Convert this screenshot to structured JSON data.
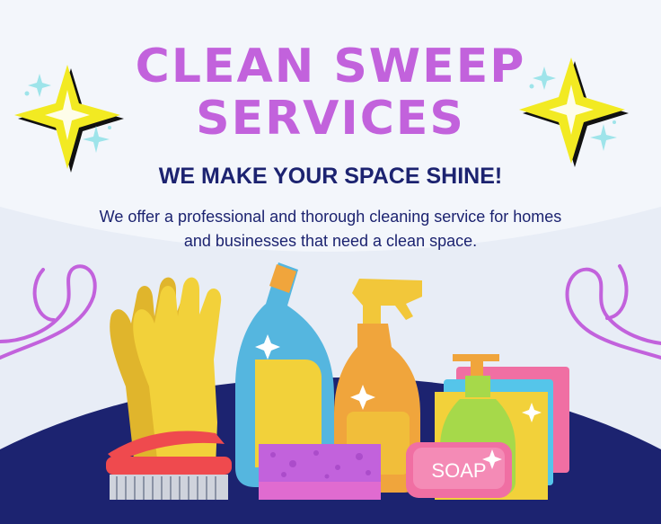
{
  "title_line1": "CLEAN SWEEP",
  "title_line2": "SERVICES",
  "tagline": "WE MAKE YOUR SPACE SHINE!",
  "description": "We offer a professional and thorough cleaning service for homes and businesses that need a clean space.",
  "soap_label": "SOAP",
  "colors": {
    "title": "#c262dc",
    "navy": "#1c2370",
    "background": "#f3f6fb",
    "sparkle_yellow": "#f2ea22"
  },
  "icons": [
    "sparkle-icon",
    "swirl-icon",
    "gloves",
    "spray-bottle",
    "detergent-bottle",
    "scrub-brush",
    "sponge",
    "soap-bar",
    "soap-dispenser"
  ]
}
